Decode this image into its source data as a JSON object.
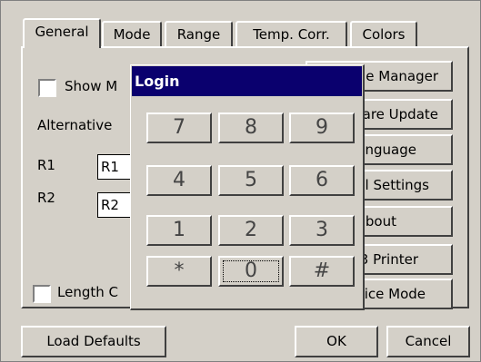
{
  "tabs": [
    {
      "label": "General",
      "active": true
    },
    {
      "label": "Mode"
    },
    {
      "label": "Range"
    },
    {
      "label": "Temp. Corr."
    },
    {
      "label": "Colors"
    }
  ],
  "general": {
    "show_checkbox_label": "Show M",
    "alternative_label": "Alternative",
    "r1_label": "R1",
    "r1_value": "R1",
    "r2_label": "R2",
    "r2_value": "R2",
    "length_checkbox_label": "Length C"
  },
  "side_buttons": [
    "e Manager",
    "are Update",
    "nguage",
    "l Settings",
    "bout",
    "3 Printer",
    "ice Mode"
  ],
  "bottom_buttons": {
    "load_defaults": "Load Defaults",
    "ok": "OK",
    "cancel": "Cancel"
  },
  "login_dialog": {
    "title": "Login",
    "keys": [
      "7",
      "8",
      "9",
      "4",
      "5",
      "6",
      "1",
      "2",
      "3",
      "*",
      "0",
      "#"
    ],
    "focused_key": "0"
  },
  "colors": {
    "face": "#d4d0c8",
    "title_bar": "#0a006e",
    "title_text": "#ffffff"
  }
}
